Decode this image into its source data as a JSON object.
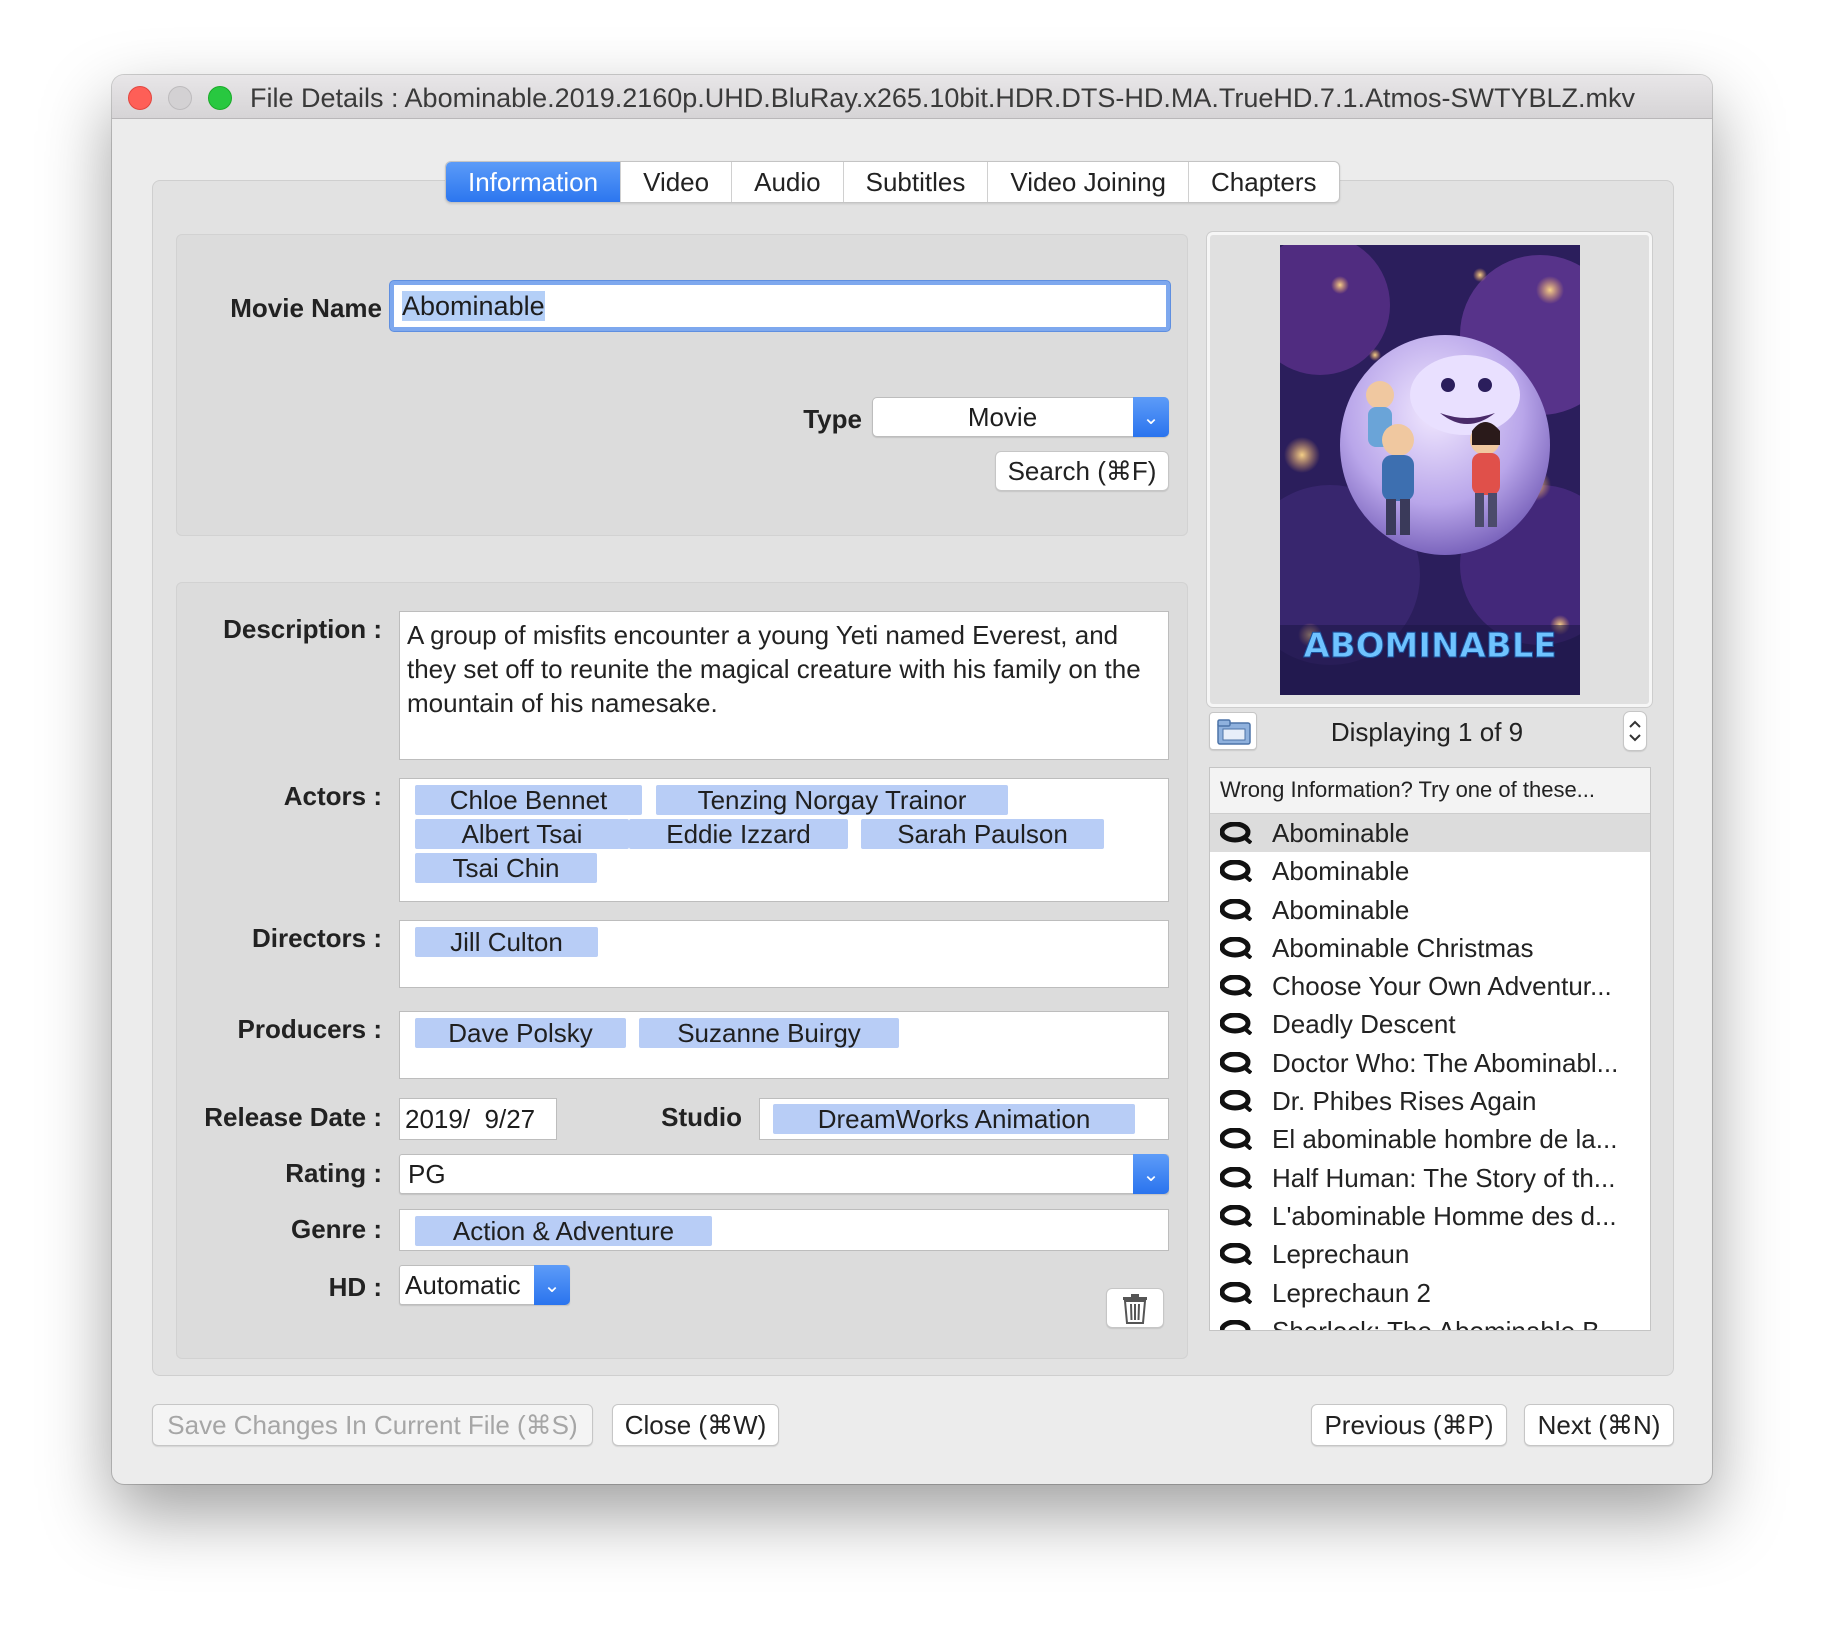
{
  "window": {
    "title": "File Details : Abominable.2019.2160p.UHD.BluRay.x265.10bit.HDR.DTS-HD.MA.TrueHD.7.1.Atmos-SWTYBLZ.mkv"
  },
  "tabs": [
    {
      "label": "Information",
      "active": true
    },
    {
      "label": "Video"
    },
    {
      "label": "Audio"
    },
    {
      "label": "Subtitles"
    },
    {
      "label": "Video Joining"
    },
    {
      "label": "Chapters"
    }
  ],
  "search_panel": {
    "movie_name_label": "Movie Name",
    "movie_name_value": "Abominable",
    "type_label": "Type",
    "type_value": "Movie",
    "search_button": "Search (⌘F)"
  },
  "details": {
    "description_label": "Description :",
    "description": "A group of misfits encounter a young Yeti named Everest, and they set off to reunite the magical creature with his family on the mountain of his namesake.",
    "actors_label": "Actors :",
    "actors": [
      "Chloe Bennet",
      "Tenzing Norgay Trainor",
      "Albert Tsai",
      "Eddie Izzard",
      "Sarah Paulson",
      "Tsai Chin"
    ],
    "directors_label": "Directors :",
    "directors": [
      "Jill Culton"
    ],
    "producers_label": "Producers :",
    "producers": [
      "Dave Polsky",
      "Suzanne Buirgy"
    ],
    "release_date_label": "Release Date :",
    "release_date": "2019/  9/27",
    "studio_label": "Studio",
    "studio": "DreamWorks Animation",
    "rating_label": "Rating :",
    "rating": "PG",
    "genre_label": "Genre :",
    "genre": "Action & Adventure",
    "hd_label": "HD :",
    "hd": "Automatic"
  },
  "poster": {
    "title_text": "ABOMINABLE",
    "counter": "Displaying 1 of 9"
  },
  "results": {
    "header": "Wrong Information? Try one of these...",
    "items": [
      "Abominable",
      "Abominable",
      "Abominable",
      "Abominable Christmas",
      "Choose Your Own Adventur...",
      "Deadly Descent",
      "Doctor Who: The Abominabl...",
      "Dr. Phibes Rises Again",
      "El abominable hombre de la...",
      "Half Human: The Story of th...",
      "L'abominable Homme des d...",
      "Leprechaun",
      "Leprechaun 2",
      "Sherlock: The Abominable B..."
    ]
  },
  "footer": {
    "save_button": "Save Changes In Current File (⌘S)",
    "close_button": "Close (⌘W)",
    "previous_button": "Previous (⌘P)",
    "next_button": "Next (⌘N)"
  },
  "icons": {
    "dropdown": "chevron-down-icon",
    "stepper": "stepper-icon",
    "folder": "folder-icon",
    "trash": "trash-icon",
    "result": "movie-result-icon"
  },
  "colors": {
    "accent": "#2c76ef",
    "token": "#b8cdf6",
    "close_light": "#fe5f57",
    "zoom_light": "#28c840"
  }
}
